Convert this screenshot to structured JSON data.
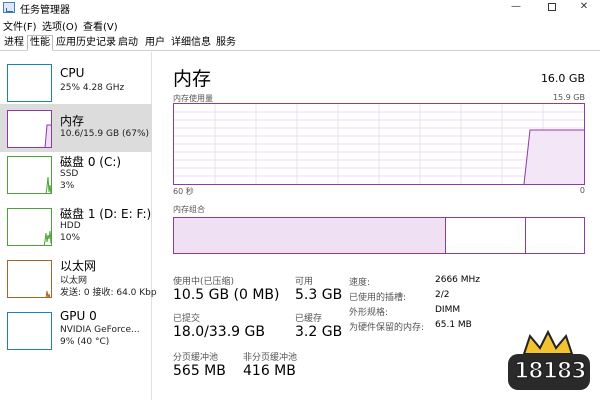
{
  "window": {
    "title": "任务管理器",
    "minimize": "—",
    "close": "✕"
  },
  "menu": [
    "文件(F)",
    "选项(O)",
    "查看(V)"
  ],
  "tabs": [
    "进程",
    "性能",
    "应用历史记录",
    "启动",
    "用户",
    "详细信息",
    "服务"
  ],
  "active_tab": "性能",
  "sidebar": {
    "items": [
      {
        "title": "CPU",
        "sub1": "25% 4.28 GHz",
        "color": "#1b7fc0",
        "icon": "cpu-graph-icon"
      },
      {
        "title": "内存",
        "sub1": "10.6/15.9 GB (67%)",
        "color": "#8b3aa6",
        "icon": "memory-graph-icon",
        "selected": true
      },
      {
        "title": "磁盘 0 (C:)",
        "sub1": "SSD",
        "sub2": "3%",
        "color": "#4ca238",
        "icon": "disk0-graph-icon"
      },
      {
        "title": "磁盘 1 (D: E: F:)",
        "sub1": "HDD",
        "sub2": "10%",
        "color": "#4ca238",
        "icon": "disk1-graph-icon"
      },
      {
        "title": "以太网",
        "sub1": "以太网",
        "sub2": "发送: 0 接收: 64.0 Kbp",
        "color": "#a7652b",
        "icon": "ethernet-graph-icon"
      },
      {
        "title": "GPU 0",
        "sub1": "NVIDIA GeForce...",
        "sub2": "9% (40 °C)",
        "color": "#1b7fc0",
        "icon": "gpu-graph-icon"
      }
    ]
  },
  "main": {
    "title": "内存",
    "total": "16.0 GB",
    "usage_label": "内存使用量",
    "usage_max": "15.9 GB",
    "axis_left": "60 秒",
    "axis_right": "0",
    "composition_label": "内存组合",
    "accent_color": "#8b3aa6",
    "stats": {
      "in_use_label": "使用中(已压缩)",
      "in_use_value": "10.5 GB (0 MB)",
      "available_label": "可用",
      "available_value": "5.3 GB",
      "committed_label": "已提交",
      "committed_value": "18.0/33.9 GB",
      "cached_label": "已缓存",
      "cached_value": "3.2 GB",
      "paged_label": "分页缓冲池",
      "paged_value": "565 MB",
      "nonpaged_label": "非分页缓冲池",
      "nonpaged_value": "416 MB"
    },
    "info": {
      "speed_label": "速度:",
      "speed_value": "2666 MHz",
      "slots_label": "已使用的插槽:",
      "slots_value": "2/2",
      "form_label": "外形规格:",
      "form_value": "DIMM",
      "reserved_label": "为硬件保留的内存:",
      "reserved_value": "65.1 MB"
    }
  },
  "watermark": {
    "text": "18183"
  }
}
